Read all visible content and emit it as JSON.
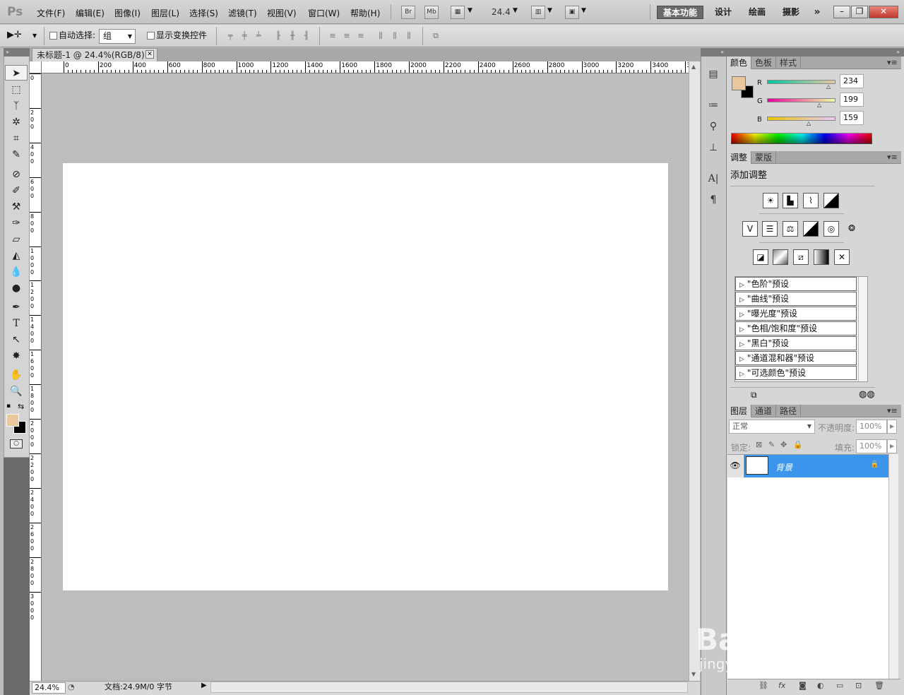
{
  "app": {
    "logo": "Ps"
  },
  "menu": [
    "文件(F)",
    "编辑(E)",
    "图像(I)",
    "图层(L)",
    "选择(S)",
    "滤镜(T)",
    "视图(V)",
    "窗口(W)",
    "帮助(H)"
  ],
  "appbar": {
    "br": "Br",
    "mb": "Mb",
    "zoom": "24.4"
  },
  "workspaces": [
    "基本功能",
    "设计",
    "绘画",
    "摄影"
  ],
  "options": {
    "auto_select": "自动选择:",
    "group": "组",
    "show_transform": "显示变换控件"
  },
  "document": {
    "tab_title": "未标题-1 @ 24.4%(RGB/8) *",
    "status_zoom": "24.4%",
    "status_info": "文档:24.9M/0 字节"
  },
  "ruler_top": [
    "0",
    "200",
    "400",
    "600",
    "800",
    "1000",
    "1200",
    "1400",
    "1600",
    "1800",
    "2000",
    "2200",
    "2400",
    "2600",
    "2800",
    "3000",
    "3200",
    "3400",
    "3"
  ],
  "ruler_left": [
    "0",
    "200",
    "400",
    "600",
    "800",
    "1000",
    "1200",
    "1400",
    "1600",
    "1800",
    "2000",
    "2200",
    "2400",
    "2600",
    "2800",
    "3000"
  ],
  "color_panel": {
    "tabs": [
      "颜色",
      "色板",
      "样式"
    ],
    "r_label": "R",
    "g_label": "G",
    "b_label": "B",
    "r": 234,
    "g": 199,
    "b": 159,
    "foreground": "#eac79f"
  },
  "adjust_panel": {
    "tabs": [
      "调整",
      "蒙版"
    ],
    "title": "添加调整",
    "presets": [
      "\"色阶\"预设",
      "\"曲线\"预设",
      "\"曝光度\"预设",
      "\"色相/饱和度\"预设",
      "\"黑白\"预设",
      "\"通道混和器\"预设",
      "\"可选颜色\"预设"
    ]
  },
  "layers_panel": {
    "tabs": [
      "图层",
      "通道",
      "路径"
    ],
    "blend": "正常",
    "opacity_label": "不透明度:",
    "opacity": "100%",
    "lock_label": "锁定:",
    "fill_label": "填充:",
    "fill": "100%",
    "layer_name": "背景"
  },
  "watermark": {
    "brand": "Bai du 经验",
    "url": "jingyan.baidu.com"
  }
}
